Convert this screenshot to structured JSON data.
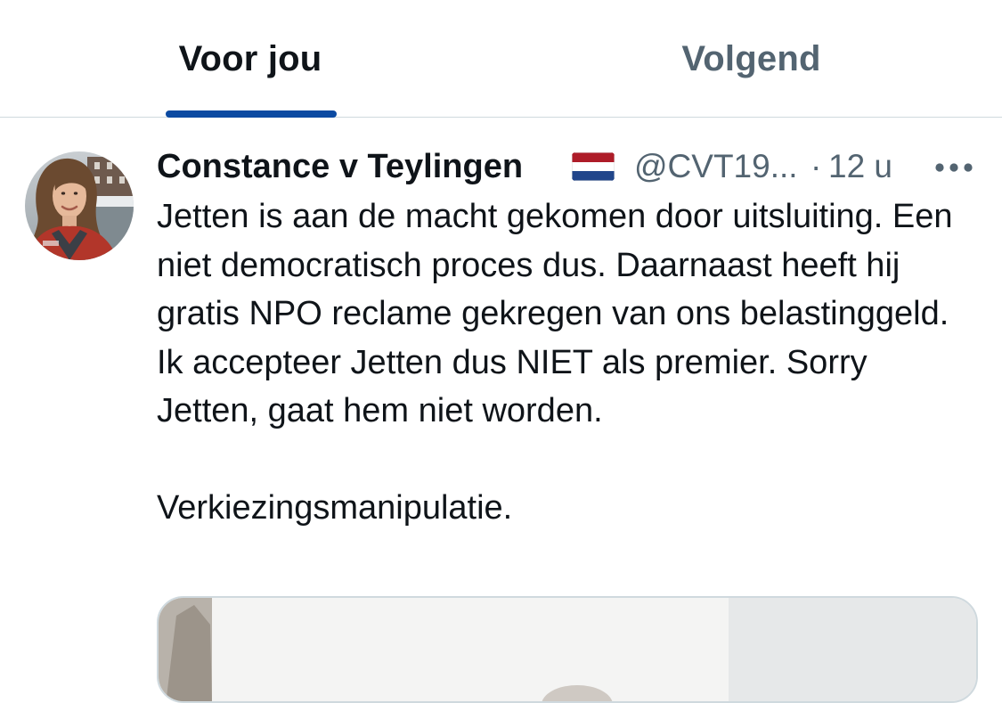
{
  "tabs": [
    {
      "label": "Voor jou",
      "active": true
    },
    {
      "label": "Volgend",
      "active": false
    }
  ],
  "tweet": {
    "display_name": "Constance v Teylingen",
    "flag": "netherlands-flag",
    "handle": "@CVT19...",
    "separator": "·",
    "time": "12 u",
    "paragraphs": [
      "Jetten is aan de macht gekomen door uitsluiting. Een niet democratisch proces dus. Daarnaast heeft hij gratis NPO reclame gekregen van ons belastinggeld. Ik accepteer Jetten dus NIET als premier. Sorry Jetten, gaat hem niet worden.",
      "Verkiezingsmanipulatie."
    ]
  },
  "icons": {
    "more": "more-horizontal-icon"
  },
  "colors": {
    "text_primary": "#0f1419",
    "text_secondary": "#536471",
    "tab_indicator": "#0b4aa2",
    "divider": "#cfd9de"
  }
}
